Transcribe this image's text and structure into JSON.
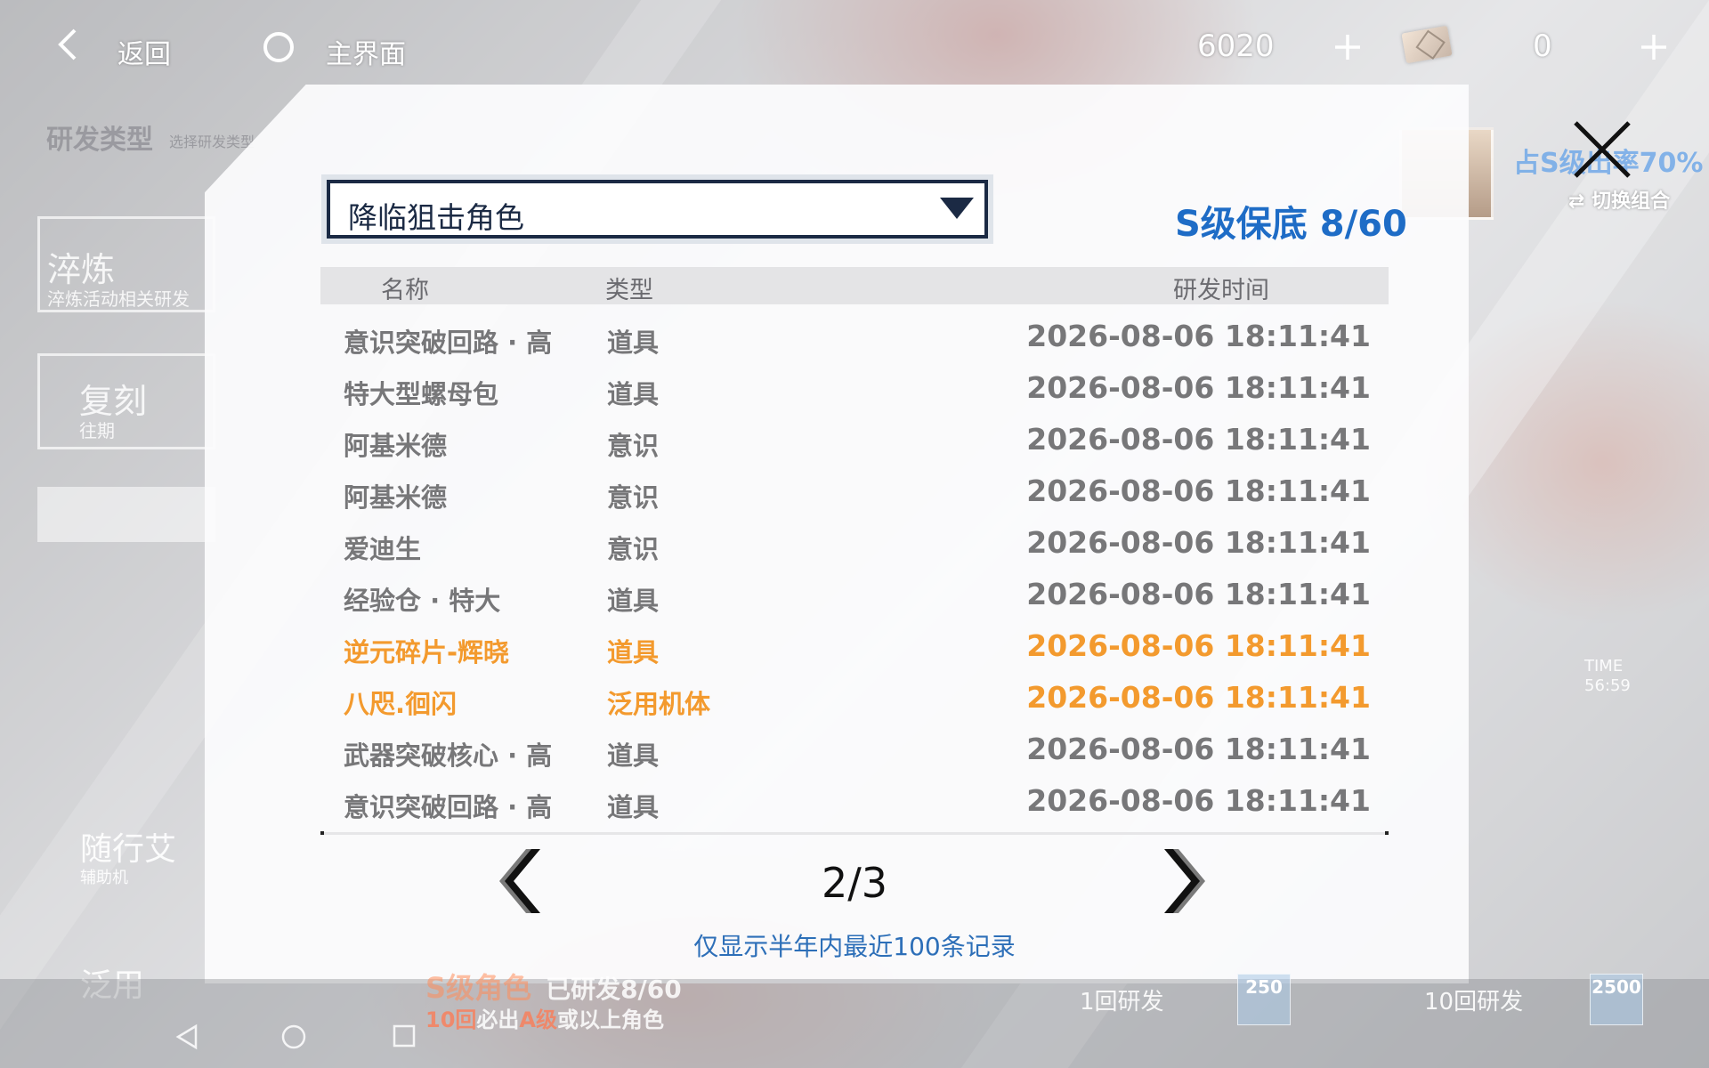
{
  "topbar": {
    "back_label": "返回",
    "home_label": "主界面",
    "currency_amount": "6020",
    "ticket_amount": "0"
  },
  "background_menu": {
    "section_title": "研发类型",
    "section_hint": "选择研发类型",
    "item1_title": "淬炼",
    "item1_sub": "淬炼活动相关研发",
    "item2_title": "复刻",
    "item2_sub": "往期",
    "item3_title": "随行艾",
    "item3_sub": "辅助机",
    "item4_title": "泛用"
  },
  "background_right": {
    "rate_text": "占S级出率70%",
    "switch_group_label": "切换组合",
    "time_label": "TIME",
    "time_value": "56:59"
  },
  "modal": {
    "pool_select": {
      "selected": "降临狙击角色"
    },
    "pity_counter": "S级保底 8/60",
    "table": {
      "headers": {
        "name": "名称",
        "type": "类型",
        "time": "研发时间"
      },
      "rows": [
        {
          "name": "意识突破回路 · 高",
          "type": "道具",
          "time": "2026-08-06 18:11:41",
          "highlight": false
        },
        {
          "name": "特大型螺母包",
          "type": "道具",
          "time": "2026-08-06 18:11:41",
          "highlight": false
        },
        {
          "name": "阿基米德",
          "type": "意识",
          "time": "2026-08-06 18:11:41",
          "highlight": false
        },
        {
          "name": "阿基米德",
          "type": "意识",
          "time": "2026-08-06 18:11:41",
          "highlight": false
        },
        {
          "name": "爱迪生",
          "type": "意识",
          "time": "2026-08-06 18:11:41",
          "highlight": false
        },
        {
          "name": "经验仓 · 特大",
          "type": "道具",
          "time": "2026-08-06 18:11:41",
          "highlight": false
        },
        {
          "name": "逆元碎片-辉晓",
          "type": "道具",
          "time": "2026-08-06 18:11:41",
          "highlight": true
        },
        {
          "name": "八咫.徊闪",
          "type": "泛用机体",
          "time": "2026-08-06 18:11:41",
          "highlight": true
        },
        {
          "name": "武器突破核心 · 高",
          "type": "道具",
          "time": "2026-08-06 18:11:41",
          "highlight": false
        },
        {
          "name": "意识突破回路 · 高",
          "type": "道具",
          "time": "2026-08-06 18:11:41",
          "highlight": false
        }
      ]
    },
    "pagination": {
      "indicator": "2/3"
    },
    "footnote": "仅显示半年内最近100条记录"
  },
  "bottom": {
    "s_char_label": "S级角色",
    "s_char_progress": "已研发8/60",
    "guarantee_prefix": "10回",
    "guarantee_mid": "必出",
    "guarantee_grade": "A级",
    "guarantee_suffix": "或以上角色",
    "draw1_label": "1回研发",
    "draw1_cost": "250",
    "draw10_label": "10回研发",
    "draw10_cost": "2500"
  },
  "colors": {
    "accent_blue": "#1e6cc6",
    "highlight_orange": "#f39a2e",
    "select_border": "#1b2a44",
    "row_text": "#777779"
  }
}
